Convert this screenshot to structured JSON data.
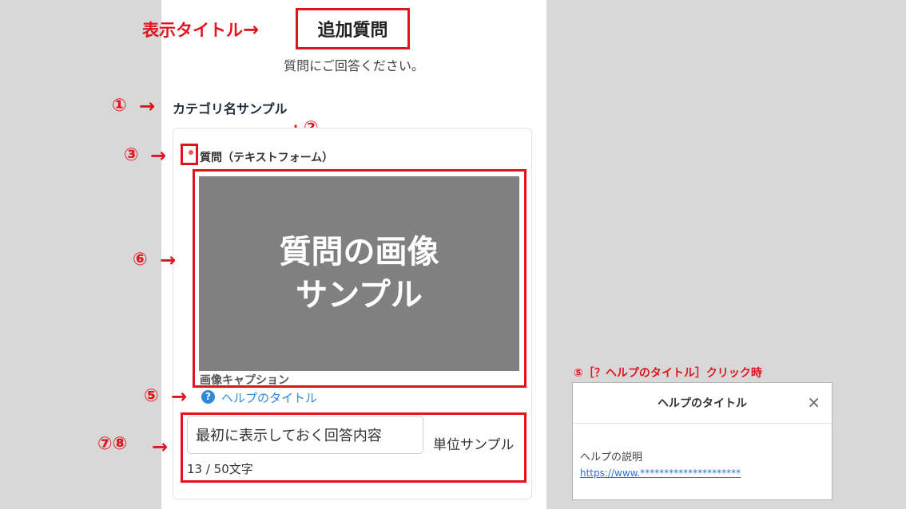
{
  "annotations": {
    "display_title_label": "表示タイトル",
    "markers": {
      "m1": "①",
      "m2": "②",
      "m3": "③",
      "m5": "⑤",
      "m6": "⑥",
      "m78": "⑦⑧"
    },
    "modal_caption": "⑤［？ヘルプのタイトル］クリック時"
  },
  "form": {
    "title": "追加質問",
    "subtitle": "質問にご回答ください。",
    "category_name": "カテゴリ名サンプル",
    "question_label": "質問（テキストフォーム）",
    "image_text_line1": "質問の画像",
    "image_text_line2": "サンプル",
    "image_caption": "画像キャプション",
    "help_icon_glyph": "?",
    "help_title": "ヘルプのタイトル",
    "answer_value": "最初に表示しておく回答内容",
    "unit": "単位サンプル",
    "char_count": "13 / 50文字"
  },
  "help_modal": {
    "title": "ヘルプのタイトル",
    "close_glyph": "×",
    "description": "ヘルプの説明",
    "link_text": "https://www.*********************"
  },
  "colors": {
    "annotation_red": "#e0141e",
    "link_blue": "#2e8ad8",
    "image_gray": "#808080"
  }
}
